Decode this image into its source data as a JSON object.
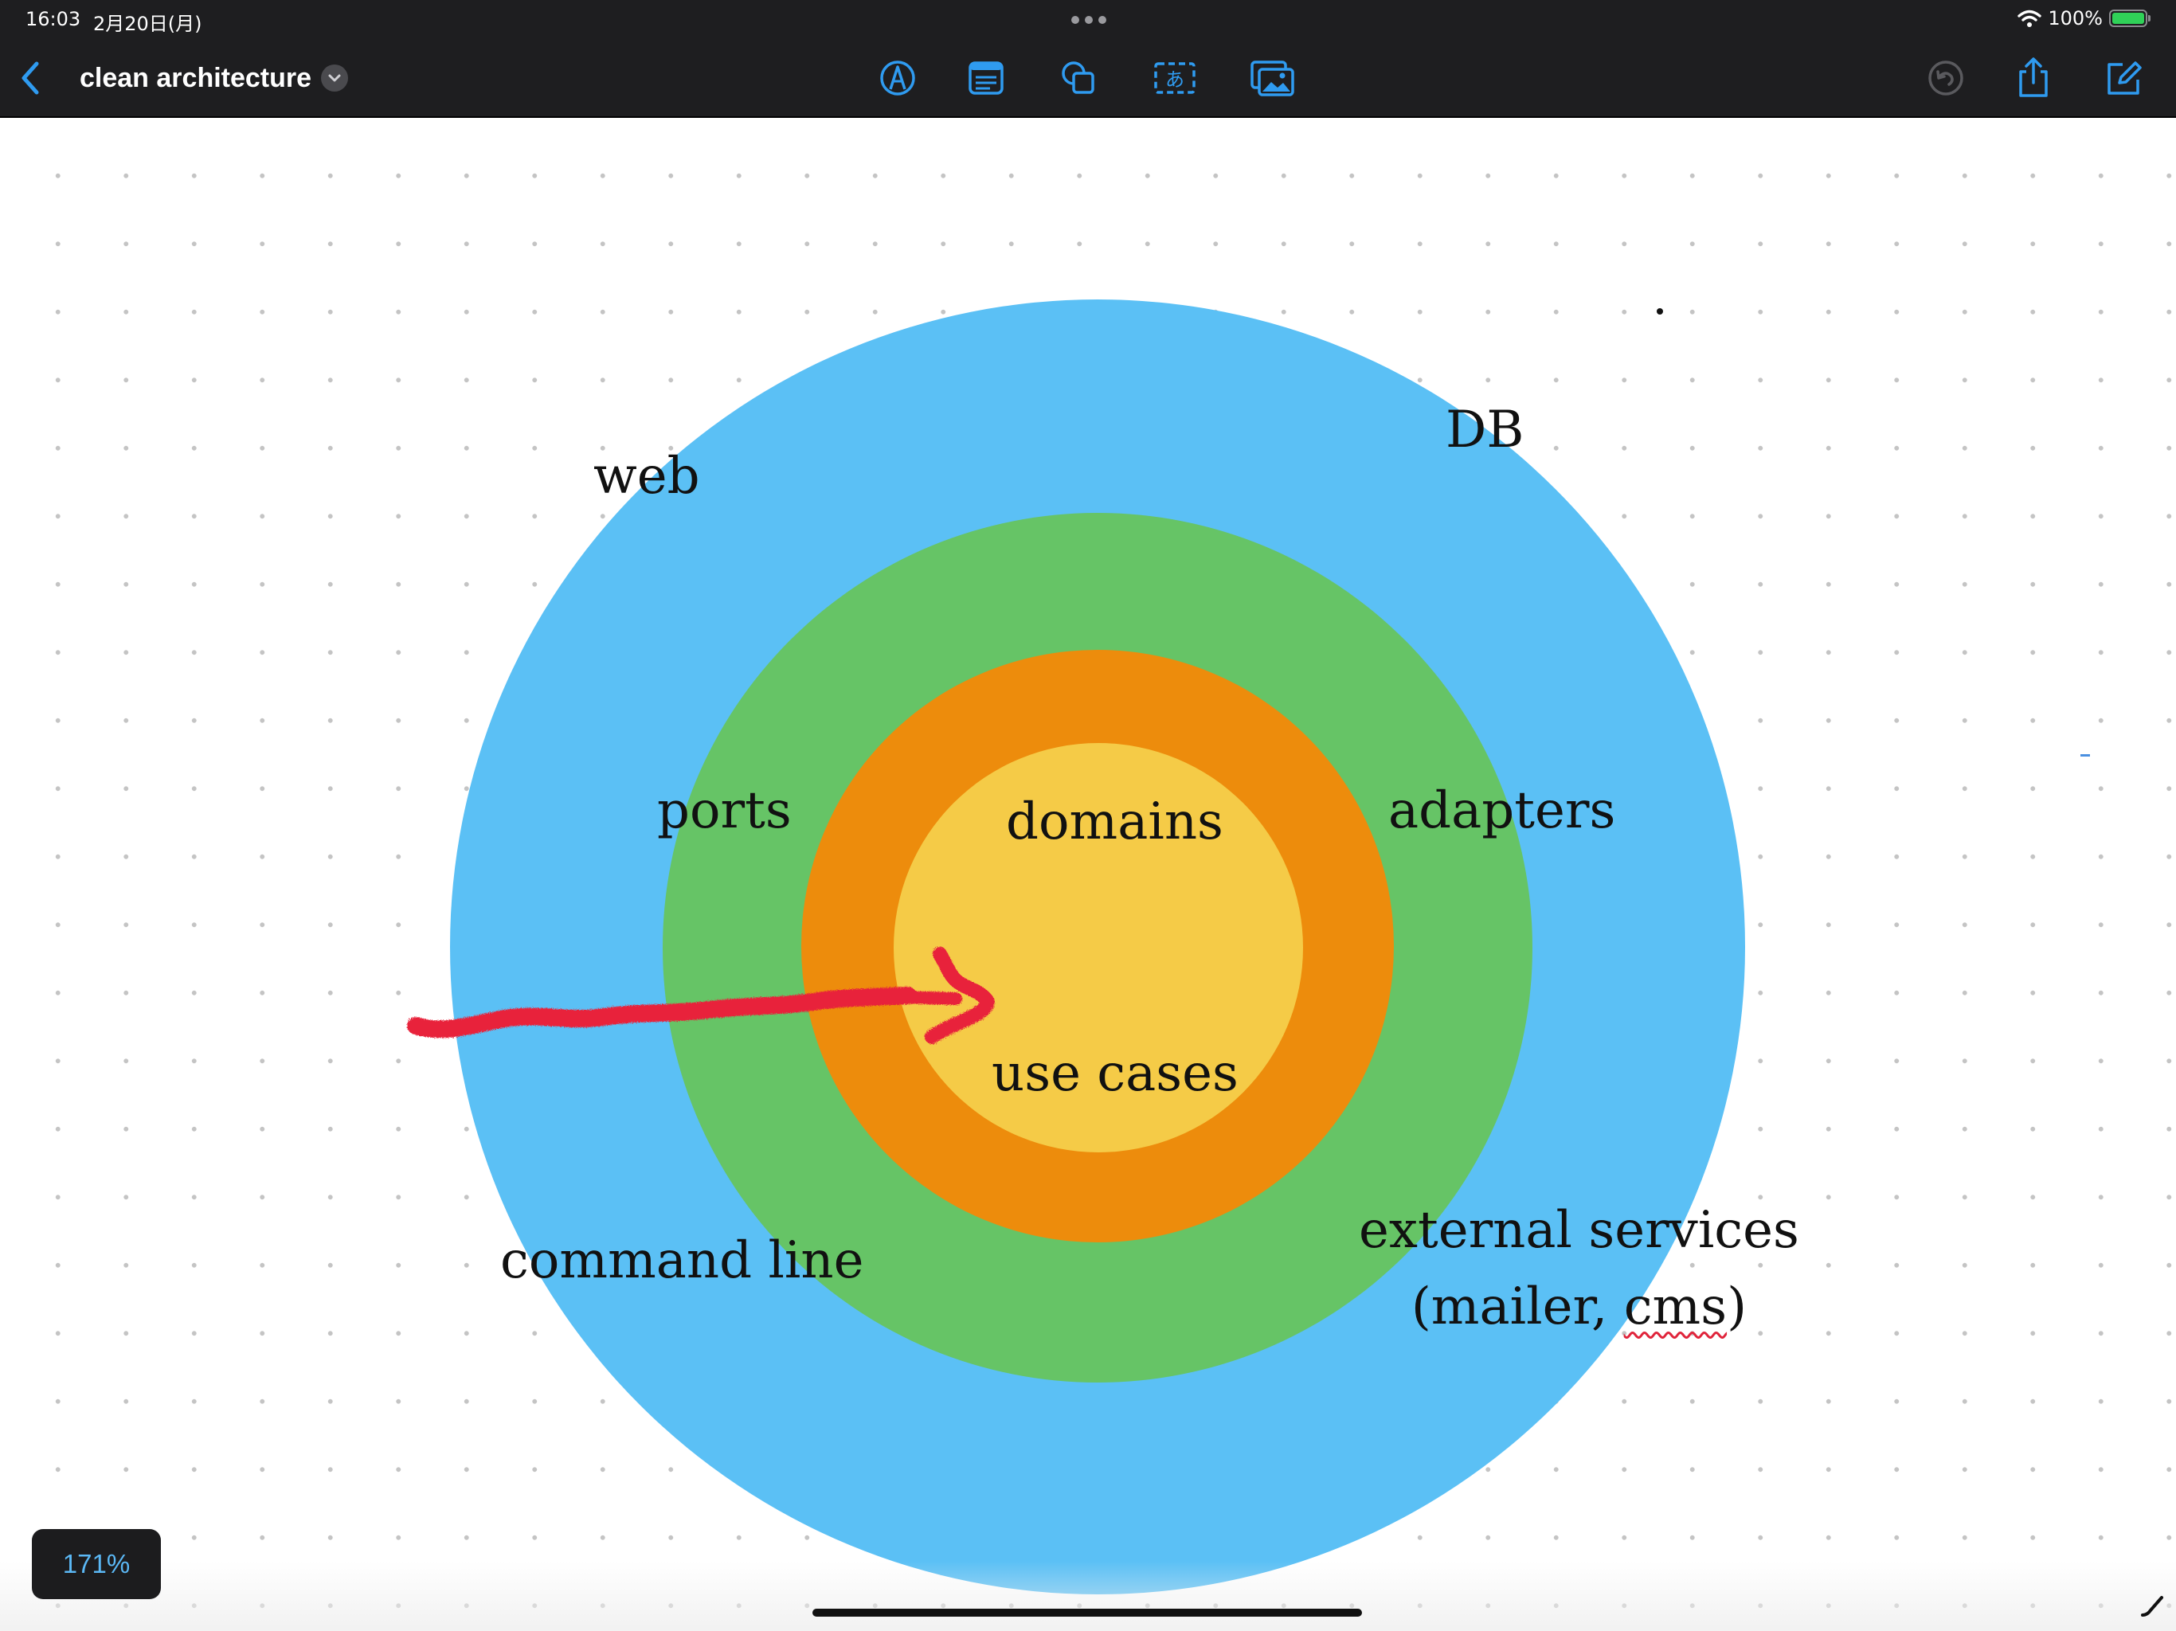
{
  "status_bar": {
    "time": "16:03",
    "date": "2月20日(月)",
    "battery": "100%",
    "icons": [
      "multitasking-dots-icon",
      "wifi-icon",
      "battery-charging-icon"
    ]
  },
  "toolbar": {
    "title": "clean architecture",
    "icons": {
      "back": "chevron-left-icon",
      "title_menu": "chevron-down-icon",
      "tools": [
        "pen-icon",
        "sticky-note-icon",
        "shapes-icon",
        "text-box-icon",
        "photo-icon"
      ],
      "right": [
        "undo-icon",
        "share-icon",
        "compose-icon"
      ]
    },
    "colors": {
      "background": "#1e1e20",
      "accent": "#2f9bf0"
    }
  },
  "diagram": {
    "rings": {
      "outer": "#5bc0f5",
      "green": "#66c466",
      "orange": "#ed8c0c",
      "core": "#f5cb47"
    },
    "arrow_color": "#e8243b",
    "labels": {
      "web": "web",
      "db": "DB",
      "ports": "ports",
      "domains": "domains",
      "adapters": "adapters",
      "use_cases": "use cases",
      "command_line": "command line",
      "external_services": "external services",
      "external_open": "(mailer, ",
      "external_cms": "cms",
      "external_close": ")"
    }
  },
  "zoom": "171%"
}
